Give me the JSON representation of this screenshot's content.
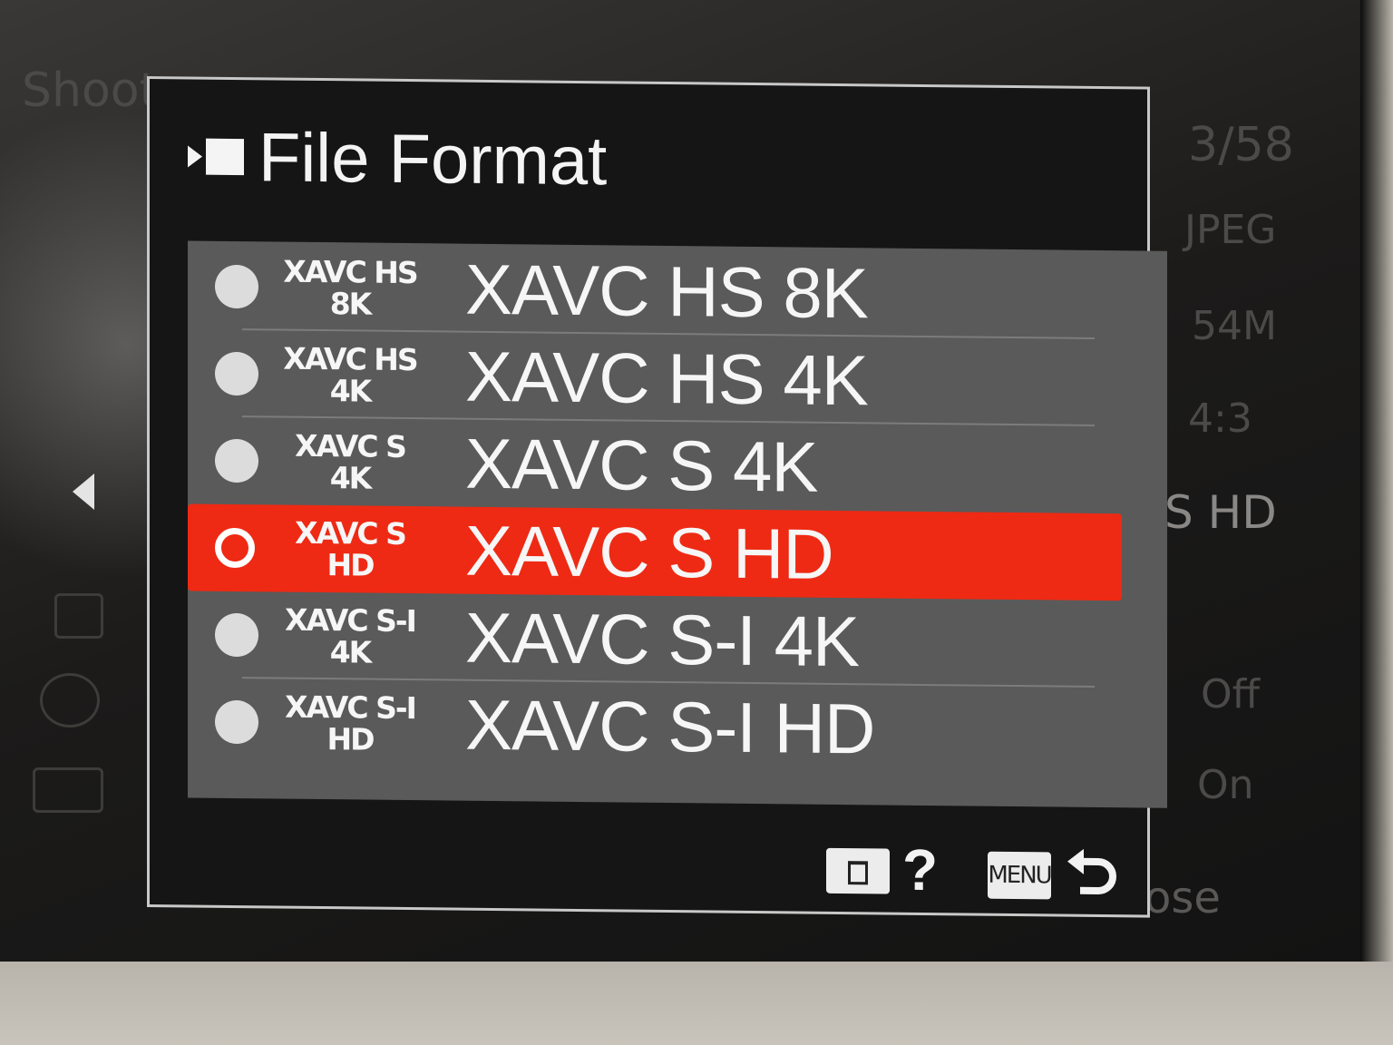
{
  "background_menu": {
    "title_fragment": "Shoot",
    "page_indicator": "3/58",
    "values": [
      "JPEG",
      "54M",
      "4:3",
      "S HD",
      "Off",
      "On"
    ],
    "bottom_fragment": "ose"
  },
  "dialog": {
    "title": "File Format",
    "title_icon": "movie-icon",
    "options": [
      {
        "badge_line1": "XAVC HS",
        "badge_line2": "8K",
        "label": "XAVC HS 8K",
        "selected": false
      },
      {
        "badge_line1": "XAVC HS",
        "badge_line2": "4K",
        "label": "XAVC HS 4K",
        "selected": false
      },
      {
        "badge_line1": "XAVC S",
        "badge_line2": "4K",
        "label": "XAVC S 4K",
        "selected": false
      },
      {
        "badge_line1": "XAVC S",
        "badge_line2": "HD",
        "label": "XAVC S HD",
        "selected": true
      },
      {
        "badge_line1": "XAVC S-I",
        "badge_line2": "4K",
        "label": "XAVC S-I 4K",
        "selected": false
      },
      {
        "badge_line1": "XAVC S-I",
        "badge_line2": "HD",
        "label": "XAVC S-I HD",
        "selected": false
      }
    ],
    "footer": {
      "help_icon": "trash-icon",
      "help_mark": "?",
      "menu_key": "MENU",
      "back_icon": "return-arrow-icon"
    }
  },
  "colors": {
    "highlight": "#ee2a14",
    "list_bg": "#5a5a5a",
    "dialog_bg": "#151515"
  }
}
